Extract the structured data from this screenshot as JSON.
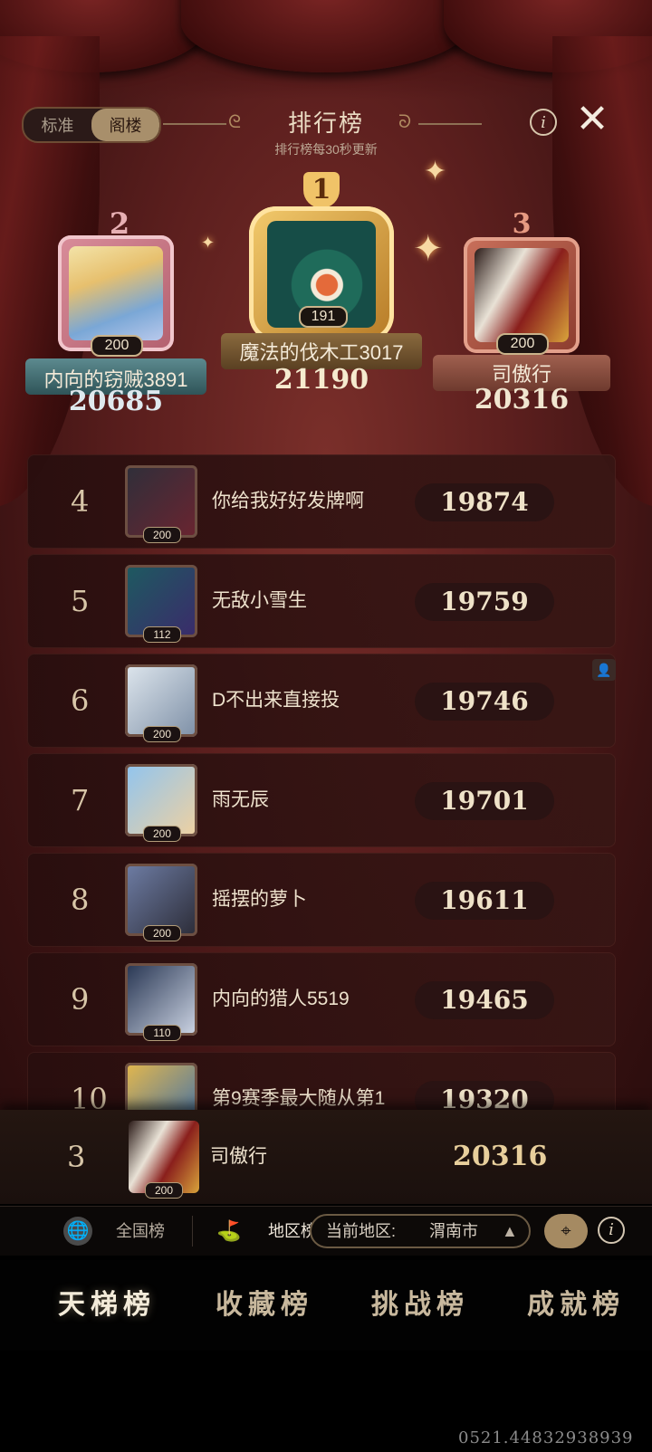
{
  "header": {
    "toggle": [
      "标准",
      "阁楼"
    ],
    "title": "排行榜",
    "subtitle": "排行榜每30秒更新",
    "info_glyph": "i",
    "close_glyph": "✕"
  },
  "podium": {
    "first": {
      "rank": "1",
      "name": "魔法的伐木工3017",
      "score": "21190",
      "level": "191"
    },
    "second": {
      "rank": "2",
      "name": "内向的窃贼3891",
      "score": "20685",
      "level": "200"
    },
    "third": {
      "rank": "3",
      "name": "司傲行",
      "score": "20316",
      "level": "200"
    }
  },
  "rows": [
    {
      "rank": "4",
      "name": "你给我好好发牌啊",
      "score": "19874",
      "level": "200"
    },
    {
      "rank": "5",
      "name": "无敌小雪生",
      "score": "19759",
      "level": "112"
    },
    {
      "rank": "6",
      "name": "D不出来直接投",
      "score": "19746",
      "level": "200"
    },
    {
      "rank": "7",
      "name": "雨无辰",
      "score": "19701",
      "level": "200"
    },
    {
      "rank": "8",
      "name": "摇摆的萝卜",
      "score": "19611",
      "level": "200"
    },
    {
      "rank": "9",
      "name": "内向的猎人5519",
      "score": "19465",
      "level": "110"
    },
    {
      "rank": "10",
      "name": "第9赛季最大随从第1",
      "score": "19320",
      "level": ""
    }
  ],
  "self": {
    "rank": "3",
    "name": "司傲行",
    "score": "20316",
    "level": "200"
  },
  "region": {
    "national_label": "全国榜",
    "regional_label": "地区榜",
    "current_label": "当前地区:",
    "current_value": "渭南市",
    "info_glyph": "i"
  },
  "bottom_nav": [
    "天梯榜",
    "收藏榜",
    "挑战榜",
    "成就榜"
  ],
  "stamp": "0521.44832938939",
  "icons": {
    "globe": "globe-icon",
    "map": "map-icon",
    "locate": "location-pin-icon",
    "info": "info-icon",
    "close": "close-icon",
    "dropdown": "triangle-up-icon",
    "sparkle": "sparkle-icon",
    "add_friend": "add-friend-icon"
  },
  "colors": {
    "gold": "#e8cf9c",
    "background": "#5c1f1e",
    "bronze": "#a58a62"
  }
}
